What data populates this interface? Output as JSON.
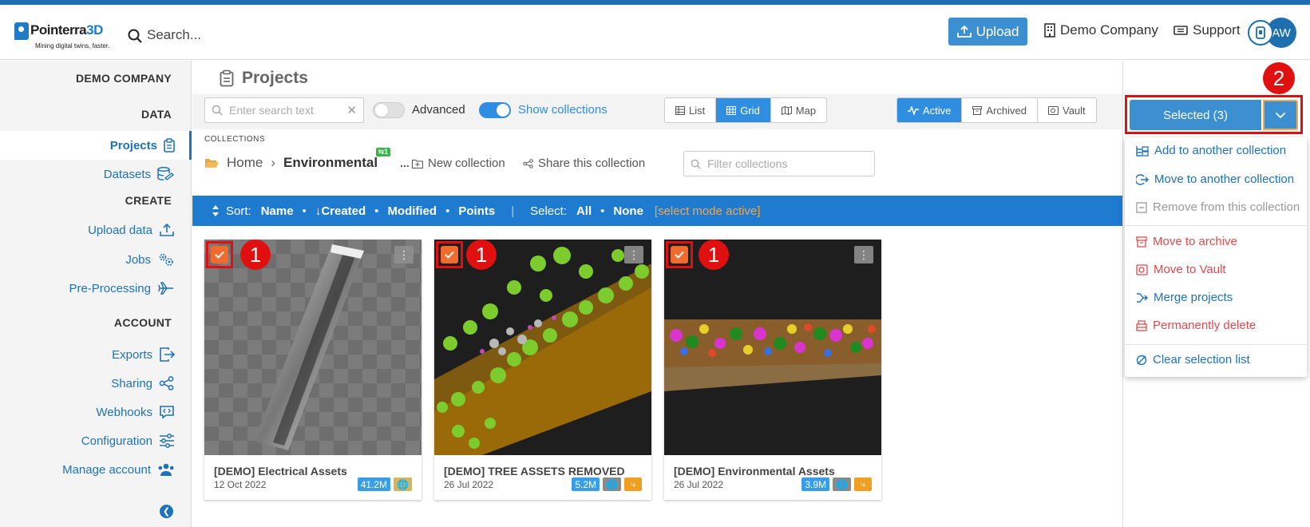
{
  "brand": {
    "name_a": "Pointerra",
    "name_b": "3D",
    "tagline": "Mining digital twins, faster."
  },
  "topbar": {
    "search_placeholder": "Search...",
    "upload_label": "Upload",
    "company_label": "Demo Company",
    "support_label": "Support",
    "avatar_initials": "AW"
  },
  "sidebar": {
    "company_heading": "DEMO COMPANY",
    "sections": [
      {
        "heading": "DATA",
        "items": [
          {
            "label": "Projects",
            "icon": "clipboard-icon",
            "active": true
          },
          {
            "label": "Datasets",
            "icon": "datasets-icon"
          }
        ]
      },
      {
        "heading": "CREATE",
        "items": [
          {
            "label": "Upload data",
            "icon": "upload-icon"
          },
          {
            "label": "Jobs",
            "icon": "gears-icon"
          },
          {
            "label": "Pre-Processing",
            "icon": "plane-icon"
          }
        ]
      },
      {
        "heading": "ACCOUNT",
        "items": [
          {
            "label": "Exports",
            "icon": "export-icon"
          },
          {
            "label": "Sharing",
            "icon": "share-icon"
          },
          {
            "label": "Webhooks",
            "icon": "webhook-icon"
          },
          {
            "label": "Configuration",
            "icon": "sliders-icon"
          },
          {
            "label": "Manage account",
            "icon": "users-icon"
          }
        ]
      }
    ]
  },
  "page": {
    "title": "Projects"
  },
  "toolbar": {
    "search_placeholder": "Enter search text",
    "advanced_label": "Advanced",
    "advanced_on": false,
    "show_collections_label": "Show collections",
    "show_collections_on": true,
    "views": [
      "List",
      "Grid",
      "Map"
    ],
    "view_selected": "Grid",
    "states": [
      "Active",
      "Archived",
      "Vault"
    ],
    "state_selected": "Active"
  },
  "collections": {
    "heading": "COLLECTIONS",
    "breadcrumb_home": "Home",
    "breadcrumb_current": "Environmental",
    "current_badge": "1",
    "more_label": "...",
    "new_collection_label": "New collection",
    "share_label": "Share this collection",
    "filter_placeholder": "Filter collections"
  },
  "sortbar": {
    "sort_label": "Sort:",
    "sort_options": [
      "Name",
      "Created",
      "Modified",
      "Points"
    ],
    "sort_active": "Created",
    "select_label": "Select:",
    "select_all": "All",
    "select_none": "None",
    "mode_text": "[select mode active]"
  },
  "projects": [
    {
      "name": "[DEMO] Electrical Assets",
      "date": "12 Oct 2022",
      "points": "41.2M",
      "selected": true,
      "callout": "1",
      "tags": [
        "points",
        "globe-gold"
      ]
    },
    {
      "name": "[DEMO] TREE ASSETS REMOVED",
      "date": "26 Jul 2022",
      "points": "5.2M",
      "selected": true,
      "callout": "1",
      "tags": [
        "points",
        "globe",
        "merge"
      ]
    },
    {
      "name": "[DEMO] Environmental Assets",
      "date": "26 Jul 2022",
      "points": "3.9M",
      "selected": true,
      "callout": "1",
      "tags": [
        "points",
        "globe",
        "merge"
      ]
    }
  ],
  "selection": {
    "button_label": "Selected (3)",
    "callout": "2"
  },
  "menu": {
    "items": [
      {
        "label": "Add to another collection",
        "style": "blue",
        "icon": "collection-add-icon"
      },
      {
        "label": "Move to another collection",
        "style": "blue",
        "icon": "move-icon"
      },
      {
        "label": "Remove from this collection",
        "style": "gray",
        "icon": "remove-icon"
      },
      {
        "label": "Move to archive",
        "style": "red",
        "icon": "archive-icon"
      },
      {
        "label": "Move to Vault",
        "style": "red",
        "icon": "vault-icon"
      },
      {
        "label": "Merge projects",
        "style": "blue",
        "icon": "merge-icon"
      },
      {
        "label": "Permanently delete",
        "style": "red",
        "icon": "delete-icon"
      },
      {
        "label": "Clear selection list",
        "style": "blue",
        "icon": "clear-icon"
      }
    ]
  },
  "colors": {
    "primary": "#3c8fd1",
    "sortbar": "#1f7bd0",
    "accent_orange": "#f06b2e",
    "callout_red": "#e01010",
    "danger": "#e24a4a",
    "points_tag": "#3a9ee6",
    "globe_tag": "#8a8a8a",
    "globe_gold_tag": "#d7b35a",
    "merge_tag": "#f0a020"
  }
}
